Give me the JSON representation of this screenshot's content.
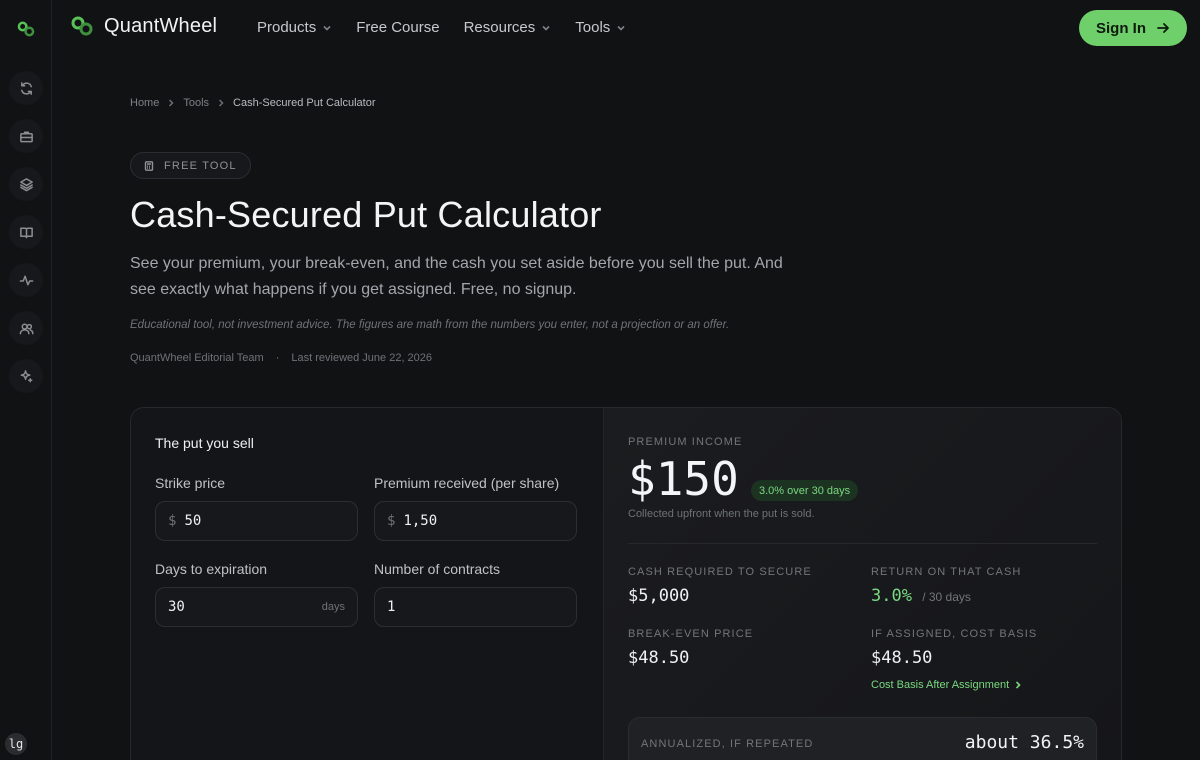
{
  "brand": {
    "name": "QuantWheel"
  },
  "nav": {
    "items": [
      {
        "label": "Products",
        "has_menu": true
      },
      {
        "label": "Free Course",
        "has_menu": false
      },
      {
        "label": "Resources",
        "has_menu": true
      },
      {
        "label": "Tools",
        "has_menu": true
      }
    ],
    "signin_label": "Sign In"
  },
  "rail": {
    "icons": [
      "refresh-icon",
      "briefcase-icon",
      "layers-icon",
      "book-icon",
      "activity-icon",
      "users-icon",
      "sparkle-icon"
    ],
    "lang_label": "lg"
  },
  "breadcrumb": {
    "items": [
      "Home",
      "Tools",
      "Cash-Secured Put Calculator"
    ]
  },
  "badge": {
    "label": "FREE TOOL"
  },
  "page": {
    "title": "Cash-Secured Put Calculator",
    "lead": "See your premium, your break-even, and the cash you set aside before you sell the put. And see exactly what happens if you get assigned. Free, no signup.",
    "disclaimer": "Educational tool, not investment advice. The figures are math from the numbers you enter, not a projection or an offer.",
    "author": "QuantWheel Editorial Team",
    "reviewed": "Last reviewed June 22, 2026"
  },
  "form": {
    "title": "The put you sell",
    "strike": {
      "label": "Strike price",
      "prefix": "$",
      "value": "50"
    },
    "premium": {
      "label": "Premium received (per share)",
      "prefix": "$",
      "value": "1,50"
    },
    "days": {
      "label": "Days to expiration",
      "value": "30",
      "suffix": "days"
    },
    "contracts": {
      "label": "Number of contracts",
      "value": "1"
    }
  },
  "results": {
    "premium_kicker": "PREMIUM INCOME",
    "premium_value": "$150",
    "premium_pill": "3.0% over 30 days",
    "premium_note": "Collected upfront when the put is sold.",
    "cash_kicker": "CASH REQUIRED TO SECURE",
    "cash_value": "$5,000",
    "return_kicker": "RETURN ON THAT CASH",
    "return_value": "3.0%",
    "return_period": "/ 30 days",
    "breakeven_kicker": "BREAK-EVEN PRICE",
    "breakeven_value": "$48.50",
    "basis_kicker": "IF ASSIGNED, COST BASIS",
    "basis_value": "$48.50",
    "basis_link": "Cost Basis After Assignment",
    "annual_kicker": "ANNUALIZED, IF REPEATED",
    "annual_value": "about 36.5%"
  },
  "colors": {
    "accent": "#6fcf6b",
    "background": "#111214"
  }
}
